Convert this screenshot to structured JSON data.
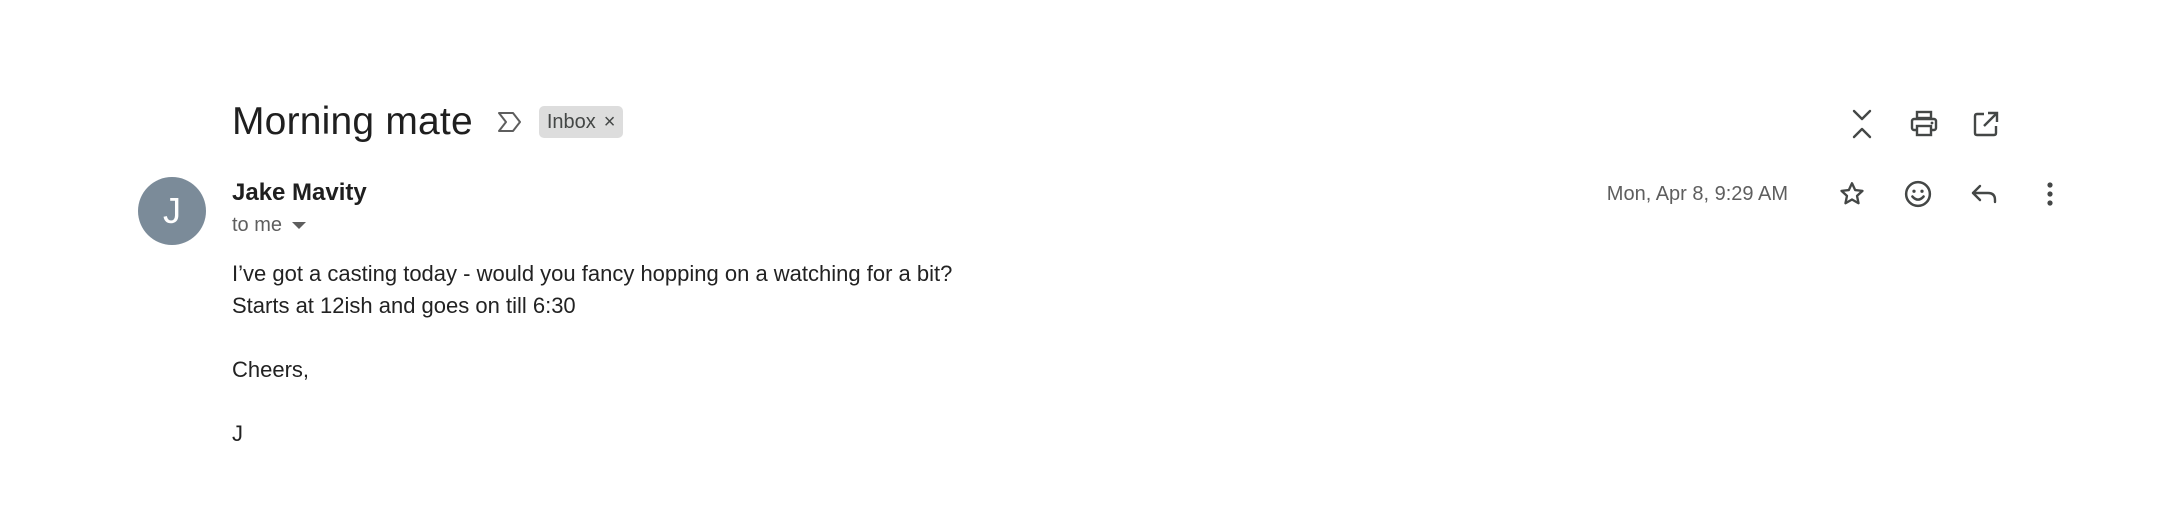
{
  "email": {
    "subject": "Morning mate",
    "label": "Inbox",
    "label_remove": "×",
    "sender_name": "Jake Mavity",
    "avatar_letter": "J",
    "avatar_color": "#7b8b99",
    "recipient": "to me",
    "date": "Mon, Apr 8, 9:29 AM",
    "body": {
      "line1": "I’ve got a casting today - would you fancy hopping on a watching for a bit?",
      "line2": "Starts at 12ish and goes on till 6:30",
      "closing": "Cheers,",
      "signature": "J"
    }
  },
  "toolbar": {
    "icons": [
      "collapse-all-icon",
      "print-icon",
      "open-in-new-window-icon"
    ]
  },
  "message_actions": {
    "icons": [
      "star-icon",
      "emoji-reaction-icon",
      "reply-icon",
      "more-vert-icon"
    ]
  }
}
